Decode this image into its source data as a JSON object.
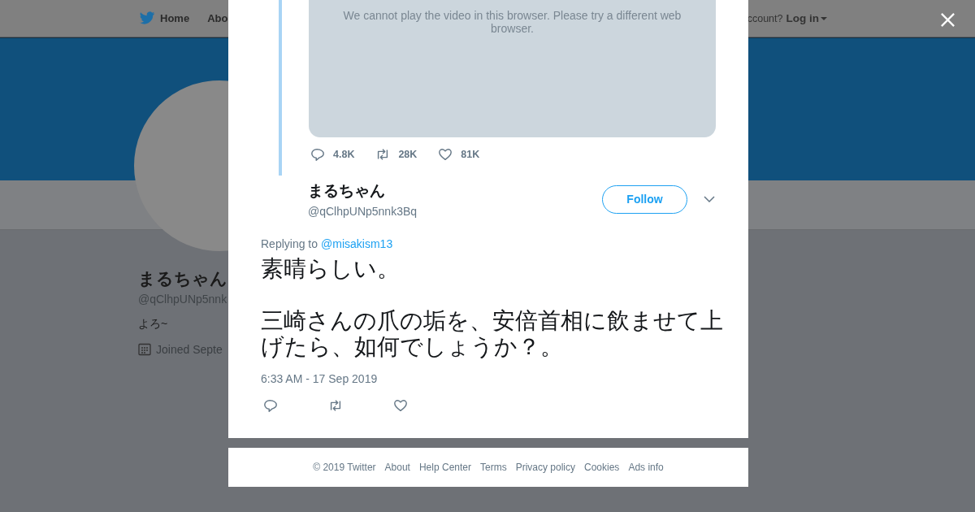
{
  "background_page": {
    "nav": [
      {
        "kind": "home",
        "label": "Home"
      },
      {
        "kind": "plain",
        "label": "Abo"
      }
    ],
    "login_prompt": "ccount?",
    "login": "Log in",
    "profile": {
      "name": "まるちゃん",
      "handle": "@qClhpUNp5nnk",
      "bio": "よろ~",
      "joined": "Joined Septe"
    }
  },
  "modal": {
    "quoted_tweet": {
      "video_message": "We cannot play the video in this browser. Please try a different web browser.",
      "stats": [
        {
          "kind": "reply",
          "count": "4.8K"
        },
        {
          "kind": "retweet",
          "count": "28K"
        },
        {
          "kind": "like",
          "count": "81K"
        }
      ]
    },
    "tweet": {
      "author": {
        "name": "まるちゃん",
        "handle": "@qClhpUNp5nnk3Bq"
      },
      "follow_button": "Follow",
      "replying_label": "Replying to",
      "reply_to": "@misakism13",
      "paragraphs": [
        "素晴らしい。",
        "三崎さんの爪の垢を、安倍首相に飲ませて上げたら、如何でしょうか？。"
      ],
      "timestamp": "6:33 AM - 17 Sep 2019",
      "actions": [
        {
          "kind": "reply"
        },
        {
          "kind": "retweet"
        },
        {
          "kind": "like"
        }
      ]
    }
  },
  "footer": [
    "© 2019 Twitter",
    "About",
    "Help Center",
    "Terms",
    "Privacy policy",
    "Cookies",
    "Ads info"
  ]
}
